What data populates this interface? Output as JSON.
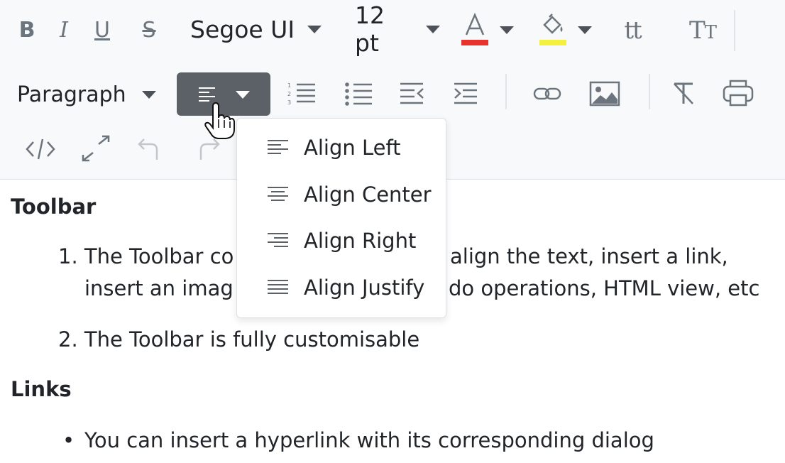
{
  "toolbar": {
    "font_family": "Segoe UI",
    "font_size": "12 pt",
    "block_format": "Paragraph",
    "font_color": "#e8322c",
    "highlight_color": "#f4f040"
  },
  "alignment_menu": {
    "items": [
      {
        "label": "Align Left",
        "icon": "align-left-icon"
      },
      {
        "label": "Align Center",
        "icon": "align-center-icon"
      },
      {
        "label": "Align Right",
        "icon": "align-right-icon"
      },
      {
        "label": "Align Justify",
        "icon": "align-justify-icon"
      }
    ]
  },
  "content": {
    "heading_toolbar": "Toolbar",
    "item1_line1_left": "1. The Toolbar co",
    "item1_line1_right": "align the text, insert a link,",
    "item1_line2_left": "insert an imag",
    "item1_line2_right": "do operations, HTML view, etc",
    "item2": "2. The Toolbar is fully customisable",
    "heading_links": "Links",
    "bullet1": "You can insert a hyperlink with its corresponding dialog"
  }
}
